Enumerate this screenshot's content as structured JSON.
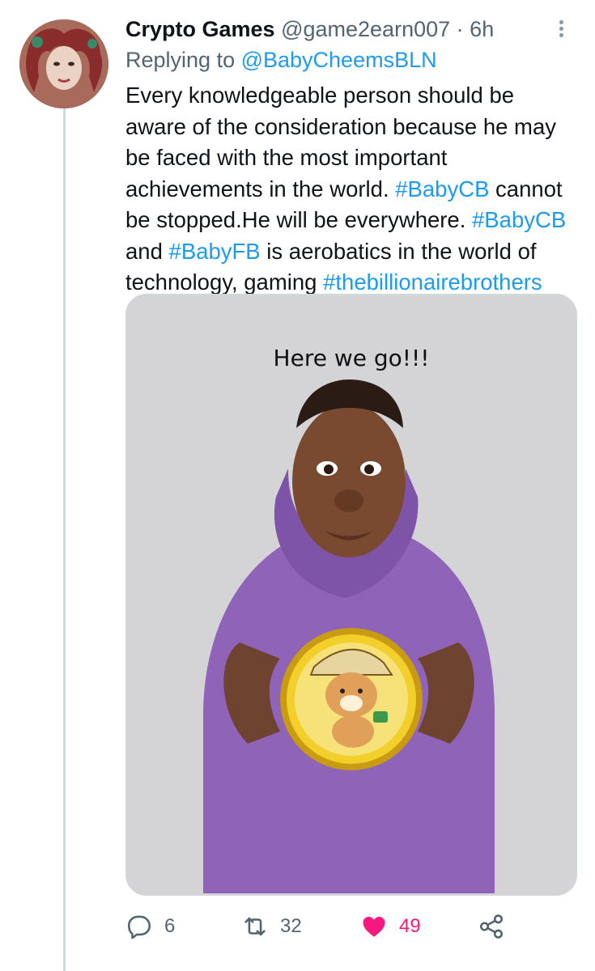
{
  "tweet": {
    "author_name": "Crypto Games",
    "author_handle": "@game2earn007",
    "separator": "·",
    "time": "6h",
    "replying_prefix": "Replying to ",
    "replying_to": "@BabyCheemsBLN",
    "text_lines": [
      [
        {
          "t": "Every knowledgeable person should be"
        }
      ],
      [
        {
          "t": "aware of the consideration because he may"
        }
      ],
      [
        {
          "t": "be faced with the most important"
        }
      ],
      [
        {
          "t": "achievements in the world. "
        },
        {
          "t": "#BabyCB",
          "tag": true
        },
        {
          "t": " cannot"
        }
      ],
      [
        {
          "t": "be stopped.He will be everywhere. "
        },
        {
          "t": "#BabyCB",
          "tag": true
        }
      ],
      [
        {
          "t": "and "
        },
        {
          "t": "#BabyFB",
          "tag": true
        },
        {
          "t": " is aerobatics in the world of"
        }
      ],
      [
        {
          "t": "technology, gaming "
        },
        {
          "t": "#thebillionairebrothers",
          "tag": true
        }
      ]
    ],
    "media_caption": "Here we go!!!"
  },
  "actions": {
    "reply_count": "6",
    "retweet_count": "32",
    "like_count": "49",
    "icons": [
      "reply-icon",
      "retweet-icon",
      "heart-icon",
      "share-icon"
    ]
  },
  "colors": {
    "link": "#1d9bf0",
    "like": "#f91880",
    "muted": "#536471",
    "hoodie": "#8e63b8",
    "coin": "#f2cf2a"
  }
}
